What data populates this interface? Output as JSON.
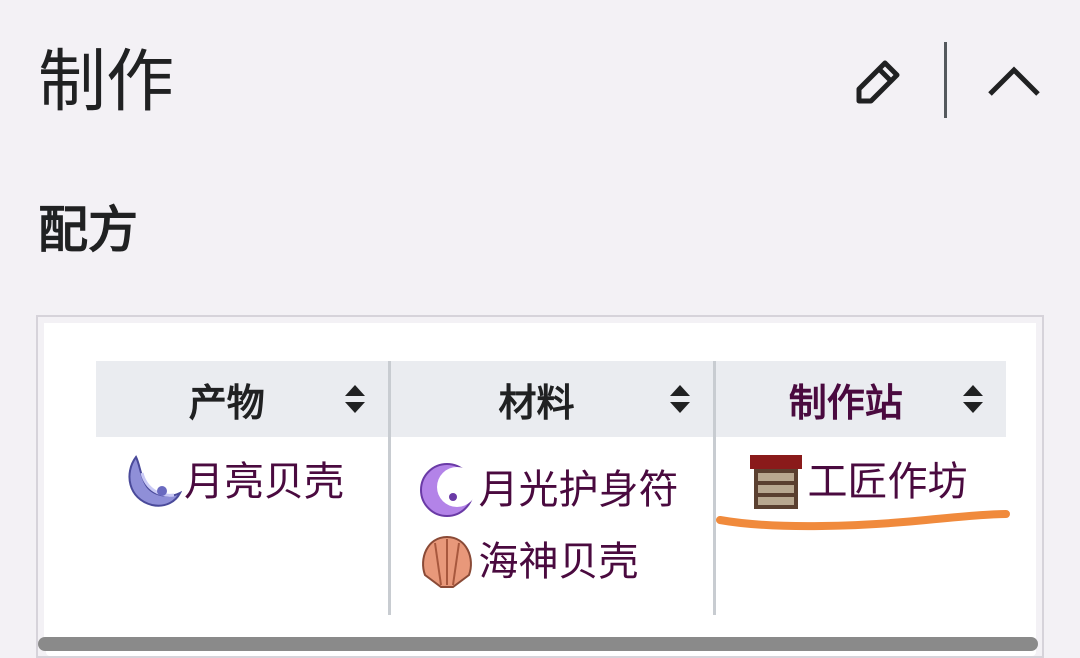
{
  "section": {
    "title": "制作",
    "edit_icon": "pencil-icon",
    "collapse_icon": "chevron-up-icon"
  },
  "recipe": {
    "title": "配方",
    "columns": [
      "产物",
      "材料",
      "制作站"
    ],
    "sort_icon": "sort-updown-icon",
    "rows": [
      {
        "product": {
          "name": "月亮贝壳",
          "icon": "moon-shell-icon"
        },
        "materials": [
          {
            "name": "月光护身符",
            "icon": "moon-charm-icon"
          },
          {
            "name": "海神贝壳",
            "icon": "neptune-shell-icon"
          }
        ],
        "station": {
          "name": "工匠作坊",
          "icon": "tinkerers-workshop-icon"
        }
      }
    ]
  },
  "colors": {
    "background": "#f3f1f5",
    "link": "#4a0a3f",
    "header_bg": "#eaecf0",
    "annotation": "#f08a3c"
  }
}
